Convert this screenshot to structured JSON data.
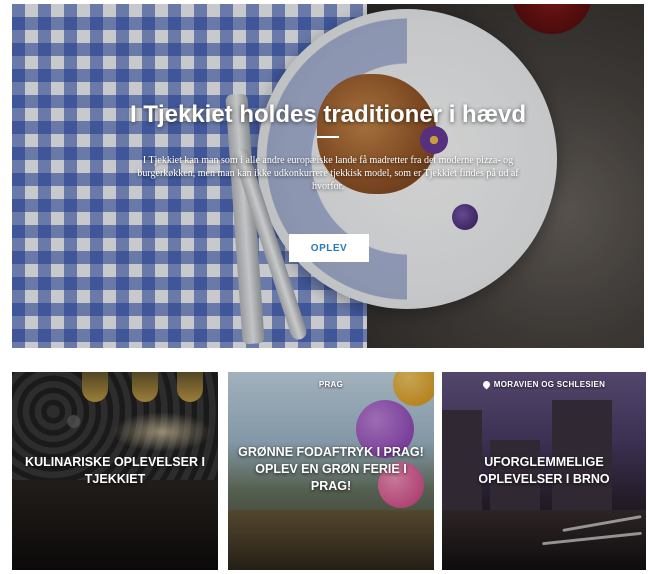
{
  "hero": {
    "title": "I Tjekkiet holdes traditioner i hævd",
    "description": "I Tjekkiet kan man som i alle andre europæiske lande få madretter fra det moderne pizza- og burgerkøkken, men man kan ikke udkonkurrere tjekkisk model, som er Tjekkiet findes på ud af hvorfor.",
    "cta_label": "OPLEV"
  },
  "cards": [
    {
      "tag": "",
      "title": "KULINARISKE OPLEVELSER I TJEKKIET"
    },
    {
      "tag": "PRAG",
      "title": "GRØNNE FODAFTRYK I PRAG! OPLEV EN GRØN FERIE I PRAG!"
    },
    {
      "tag": "MORAVIEN OG SCHLESIEN",
      "title": "UFORGLEMMELIGE OPLEVELSER I BRNO"
    }
  ]
}
